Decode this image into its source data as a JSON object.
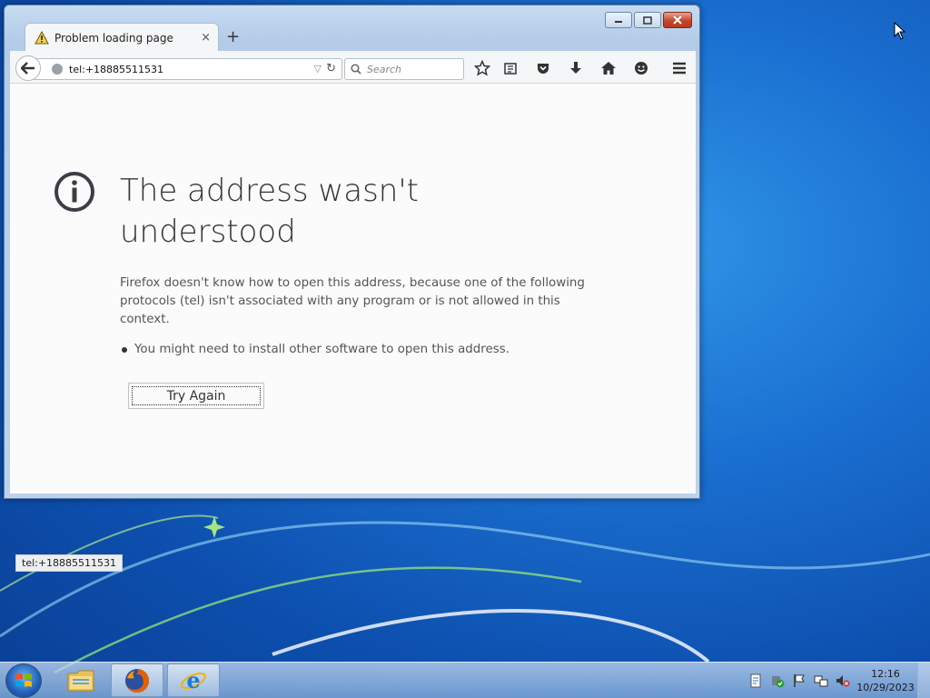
{
  "browser": {
    "tab_title": "Problem loading page",
    "tab_close": "×",
    "new_tab": "+",
    "url": "tel:+18885511531",
    "search_placeholder": "Search"
  },
  "error_page": {
    "heading": "The address wasn't understood",
    "description": "Firefox doesn't know how to open this address, because one of the following protocols (tel) isn't associated with any program or is not allowed in this context.",
    "bullet": "You might need to install other software to open this address.",
    "try_again_label": "Try Again"
  },
  "statusbar": {
    "text": "tel:+18885511531"
  },
  "taskbar": {
    "apps": [
      "windows-explorer",
      "firefox",
      "internet-explorer"
    ],
    "clock_time": "12:16",
    "clock_date": "10/29/2023"
  },
  "colors": {
    "desktop_blue": "#1a6fd0",
    "page_background": "#fbfbfb",
    "heading_text": "#333333",
    "close_button_red": "#c4452b"
  }
}
